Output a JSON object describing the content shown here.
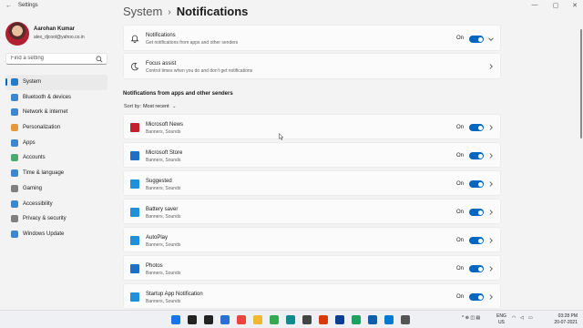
{
  "window": {
    "title": "Settings",
    "controls": [
      "—",
      "▢",
      "✕"
    ]
  },
  "profile": {
    "name": "Aarohan Kumar",
    "email": "alex_djcool@yahoo.co.in"
  },
  "search": {
    "placeholder": "Find a setting"
  },
  "nav": [
    {
      "label": "System",
      "icon": "system-icon",
      "color": "#0067c0",
      "active": true
    },
    {
      "label": "Bluetooth & devices",
      "icon": "bluetooth-icon",
      "color": "#1a73c9"
    },
    {
      "label": "Network & internet",
      "icon": "network-icon",
      "color": "#1a73c9"
    },
    {
      "label": "Personalization",
      "icon": "brush-icon",
      "color": "#e08a1a"
    },
    {
      "label": "Apps",
      "icon": "apps-icon",
      "color": "#1a73c9"
    },
    {
      "label": "Accounts",
      "icon": "accounts-icon",
      "color": "#2e9e5b"
    },
    {
      "label": "Time & language",
      "icon": "globe-clock-icon",
      "color": "#1a73c9"
    },
    {
      "label": "Gaming",
      "icon": "gamepad-icon",
      "color": "#6b6b6b"
    },
    {
      "label": "Accessibility",
      "icon": "accessibility-icon",
      "color": "#1a73c9"
    },
    {
      "label": "Privacy & security",
      "icon": "shield-icon",
      "color": "#6b6b6b"
    },
    {
      "label": "Windows Update",
      "icon": "update-icon",
      "color": "#1a73c9"
    }
  ],
  "breadcrumb": {
    "parent": "System",
    "separator": "›",
    "current": "Notifications"
  },
  "top_cards": {
    "notifications": {
      "title": "Notifications",
      "subtitle": "Get notifications from apps and other senders",
      "state": "On"
    },
    "focus": {
      "title": "Focus assist",
      "subtitle": "Control times when you do and don't get notifications"
    }
  },
  "section": {
    "label": "Notifications from apps and other senders",
    "sort_label": "Sort by:",
    "sort_value": "Most recent"
  },
  "apps": [
    {
      "name": "Microsoft News",
      "sub": "Banners, Sounds",
      "state": "On",
      "icon": "news-icon",
      "color": "#c2222b"
    },
    {
      "name": "Microsoft Store",
      "sub": "Banners, Sounds",
      "state": "On",
      "icon": "store-icon",
      "color": "#1f6fc4"
    },
    {
      "name": "Suggested",
      "sub": "Banners, Sounds",
      "state": "On",
      "icon": "suggested-icon",
      "color": "#1f8fd8"
    },
    {
      "name": "Battery saver",
      "sub": "Banners, Sounds",
      "state": "On",
      "icon": "battery-icon",
      "color": "#1f8fd8"
    },
    {
      "name": "AutoPlay",
      "sub": "Banners, Sounds",
      "state": "On",
      "icon": "autoplay-icon",
      "color": "#1f8fd8"
    },
    {
      "name": "Photos",
      "sub": "Banners, Sounds",
      "state": "On",
      "icon": "photos-icon",
      "color": "#1f6fc4"
    },
    {
      "name": "Startup App Notification",
      "sub": "Banners, Sounds",
      "state": "On",
      "icon": "startup-icon",
      "color": "#1f8fd8"
    }
  ],
  "taskbar": {
    "icons": [
      {
        "name": "start-icon",
        "color": "#1a73e8"
      },
      {
        "name": "search-icon",
        "color": "#222222"
      },
      {
        "name": "task-view-icon",
        "color": "#222222"
      },
      {
        "name": "widgets-icon",
        "color": "#2a6fd8"
      },
      {
        "name": "chrome-icon",
        "color": "#e8453c"
      },
      {
        "name": "file-explorer-icon",
        "color": "#f2b632"
      },
      {
        "name": "chrome-icon",
        "color": "#34a853"
      },
      {
        "name": "edge-icon",
        "color": "#0f8b8d"
      },
      {
        "name": "calendar-icon",
        "color": "#444444"
      },
      {
        "name": "app-icon",
        "color": "#d83b01"
      },
      {
        "name": "photoshop-icon",
        "color": "#0b3d91"
      },
      {
        "name": "chrome-icon",
        "color": "#1aa260"
      },
      {
        "name": "app-icon",
        "color": "#0f5fa8"
      },
      {
        "name": "store-icon",
        "color": "#0078d4"
      },
      {
        "name": "settings-icon",
        "color": "#555555"
      }
    ],
    "tray": "^  ⊕  ◫  ▤",
    "lang_top": "ENG",
    "lang_bottom": "US",
    "time": "03:28 PM",
    "date": "20-07-2021"
  }
}
